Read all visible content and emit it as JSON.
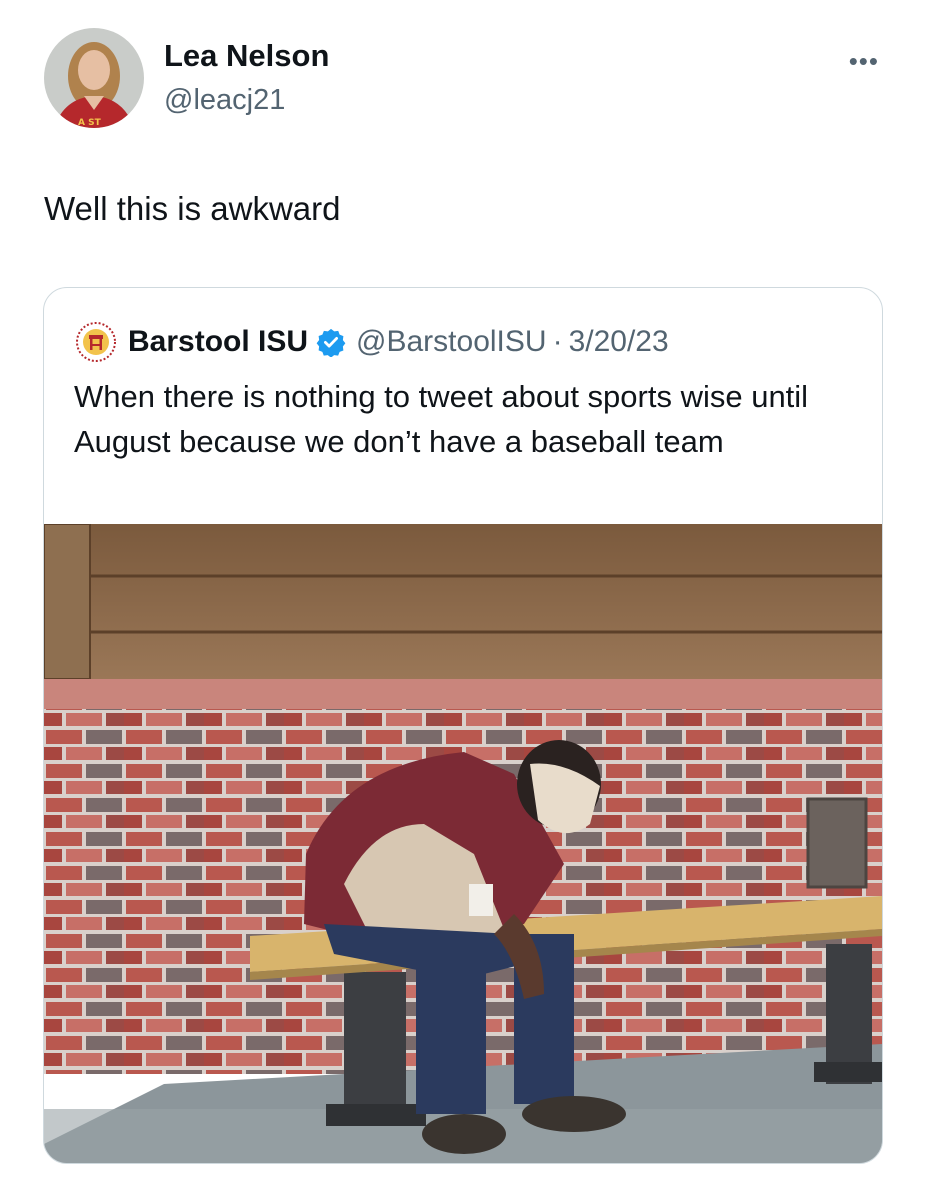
{
  "tweet": {
    "author_name": "Lea Nelson",
    "author_handle": "@leacj21",
    "more_label": "•••",
    "avatar_jersey_text": "A ST",
    "text": "Well this is awkward"
  },
  "quote": {
    "author_name": "Barstool ISU",
    "author_handle": "@BarstoolISU",
    "separator": "·",
    "date": "3/20/23",
    "verified": true,
    "text": "When there is nothing to tweet about sports wise until August because we don’t have a baseball team",
    "media": {
      "description_icon": "photo",
      "scene": "worker slumped on bench against brick wall"
    }
  },
  "colors": {
    "text_primary": "#0f1419",
    "text_secondary": "#536471",
    "verified_blue": "#1d9bf0",
    "border": "#cfd9de"
  }
}
